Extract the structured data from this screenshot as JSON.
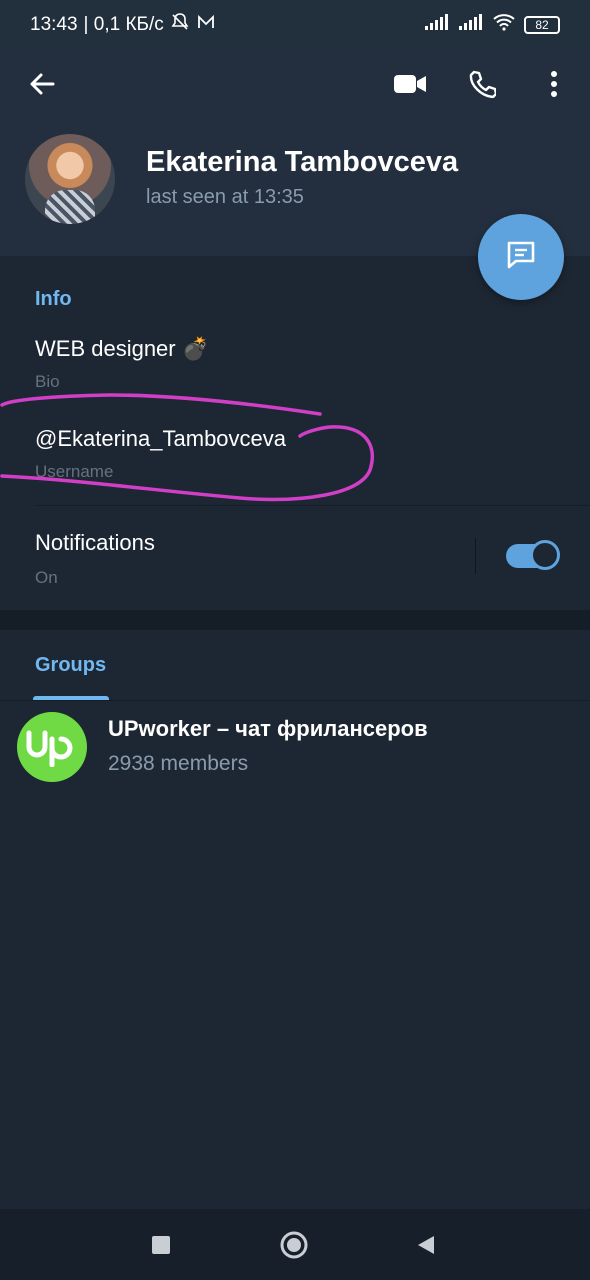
{
  "status_bar": {
    "time": "13:43",
    "speed": "| 0,1 КБ/с",
    "battery": "82"
  },
  "header": {
    "back_icon": "arrow-left-icon",
    "video_icon": "video-camera-icon",
    "call_icon": "phone-icon",
    "menu_icon": "more-vertical-icon",
    "name": "Ekaterina Tambovceva",
    "status": "last seen at 13:35",
    "fab_icon": "message-icon"
  },
  "info": {
    "title": "Info",
    "bio_value": "WEB designer 💣",
    "bio_label": "Bio",
    "username_value": "@Ekaterina_Tambovceva",
    "username_label": "Username",
    "notifications_value": "Notifications",
    "notifications_label": "On",
    "notifications_enabled": true
  },
  "groups": {
    "tab_label": "Groups",
    "items": [
      {
        "name": "UPworker – чат фрилансеров",
        "members": "2938 members",
        "logo_text": "up"
      }
    ]
  },
  "colors": {
    "accent": "#5ea3de",
    "section_title": "#71b8f0",
    "background": "#1d2733",
    "header": "#232f3e",
    "annotation": "#d13fc6",
    "upwork_green": "#6fda44"
  },
  "nav": {
    "recents_icon": "square-icon",
    "home_icon": "circle-icon",
    "back_icon": "triangle-back-icon"
  }
}
